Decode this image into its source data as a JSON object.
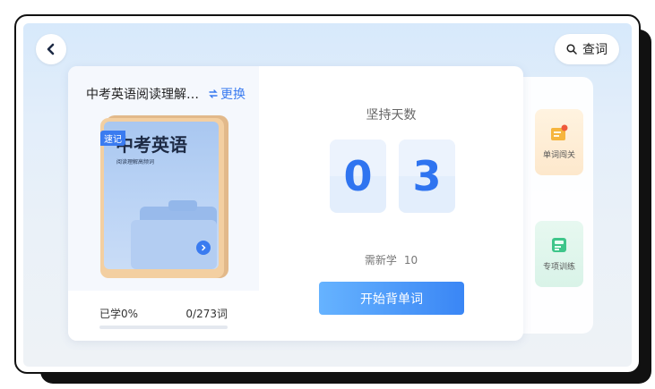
{
  "header": {
    "search_label": "查词"
  },
  "book": {
    "title": "中考英语阅读理解…",
    "switch_label": "更换",
    "cover_title": "中考英语",
    "cover_subtitle": "阅读理解高频词",
    "tag": "速记",
    "learned_label": "已学0%",
    "word_count": "0/273词",
    "progress": 0
  },
  "streak": {
    "label": "坚持天数",
    "digits": [
      "0",
      "3"
    ]
  },
  "plan": {
    "need_label": "需新学",
    "need_value": "10",
    "start_label": "开始背单词"
  },
  "side": {
    "items": [
      {
        "label": "单词闯关",
        "icon": "flag-board-icon"
      },
      {
        "label": "专项训练",
        "icon": "abc-book-icon"
      }
    ]
  },
  "colors": {
    "accent": "#3a7bf0",
    "digit": "#2f74f0",
    "digit_bg": "#e3eefc"
  }
}
